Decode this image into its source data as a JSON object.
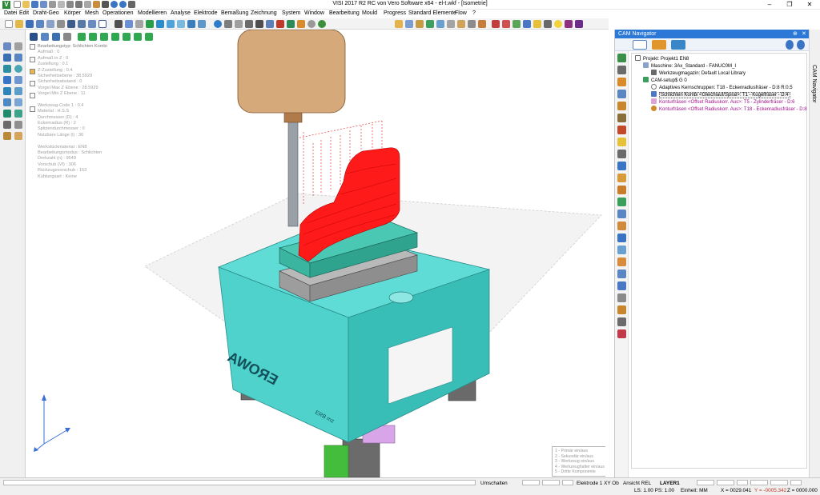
{
  "window": {
    "title": "VISI 2017 R2 RC von Vero Software x64 - el-t.wkf - [Isometrie]",
    "app_icon": "V",
    "minimize": "–",
    "maximize": "❐",
    "close": "✕"
  },
  "menu": [
    "Datei",
    "Edit",
    "Draht-Geo",
    "Körper",
    "Mesh",
    "Operationen",
    "Modellieren",
    "Analyse",
    "Elektrode",
    "Bemaßung",
    "Zeichnung",
    "System",
    "Window",
    "Bearbeitung",
    "Mould",
    "Progress",
    "Standard Elemente",
    "Flow",
    "?"
  ],
  "info_panel": [
    "Bearbeitungstyp: Schlichten Kombi",
    "Aufmaß : 0",
    "Aufmaß in Z : 0",
    "Zustellung : 0.1",
    "Z-Zustellung : 0.4",
    "Sicherheitsebene : 38.5929",
    "Sicherheitsabstand : 0",
    "Vorgel.Max Z Ebene : 28.5929",
    "Vorgel.Min Z Ebene : 11",
    "",
    "Werkzeug-Code 1 : 0.4",
    "Material : H.S.S",
    "Durchmesser (D) : 4",
    "Eckenradius (R) : 2",
    "Spitzendurchmesser : 0",
    "Nutzbare Länge (l) : 30",
    "",
    "Werkstückmaterial : EN8",
    "Bearbeitungsmodus : Schlichten",
    "Drehzahl (n) : 9549",
    "Vorschub (Vf) : 306",
    "Rückzugsvorschub : 153",
    "Kühlungsart : Keine"
  ],
  "legend": [
    "1 - Primär ein/aus",
    "2 - Sekundär ein/aus",
    "3 - Werkzeug ein/aus",
    "4 - Werkzeughalter ein/aus",
    "5 - Dritte Komponente"
  ],
  "model_text": {
    "brand": "EROWA",
    "sub": "ERB mz"
  },
  "cam_navigator": {
    "title": "CAM Navigator",
    "pin": "⊕",
    "close": "✕",
    "tree": [
      {
        "label": "Projekt: Projekt1 EN8",
        "level": 0,
        "color": "#000000",
        "icon": "project-icon"
      },
      {
        "label": "Maschine: 3Ax_Standard - FANUC0M_I",
        "level": 1,
        "color": "#000000",
        "icon": "machine-icon"
      },
      {
        "label": "Werkzeugmagazin: Default Local Library",
        "level": 2,
        "color": "#000000",
        "icon": "magazine-icon"
      },
      {
        "label": "CAM-setup$ G 0",
        "level": 1,
        "color": "#000000",
        "icon": "setup-icon"
      },
      {
        "label": "Adaptives Kernschruppen: T18 - Eckenradiusfräser - D:8 R:0.5",
        "level": 2,
        "color": "#000000",
        "icon": "roughing-icon"
      },
      {
        "label": "Schlichten Kombi <Gleichlauf/Spiral>: T1 - Kugelfräser - D:4",
        "level": 2,
        "color": "#000000",
        "icon": "finishing-icon",
        "selected": true
      },
      {
        "label": "Konturfräsen <Offset Radiuskorr. Aus>: T5 - Zylinderfräser - D:6",
        "level": 2,
        "color": "#a0108c",
        "icon": "contour-icon"
      },
      {
        "label": "Konturfräsen <Offset Radiuskorr. Aus>: T18 - Eckenradiusfräser - D:8",
        "level": 2,
        "color": "#a0108c",
        "icon": "contour-icon"
      }
    ],
    "side_label": "CAM Navigator"
  },
  "statusbar": {
    "mode": "Umschalten",
    "electrode": "Elektrode 1 XY Ob",
    "view_ref": "Ansicht REL",
    "layer": "LAYER1",
    "ls_ps": "LS: 1.00 PS: 1.00",
    "units": "Einheit: MM",
    "x_label": "X = 0029.041",
    "y_label": "Y = -0005.342",
    "z_label": "Z = 0000.000"
  },
  "colors": {
    "accent": "#2b78d6",
    "fixture": "#48d4ce",
    "toolpath": "#ff1a1a",
    "holder": "#d4a97a",
    "plate": "#3fbfaa"
  }
}
